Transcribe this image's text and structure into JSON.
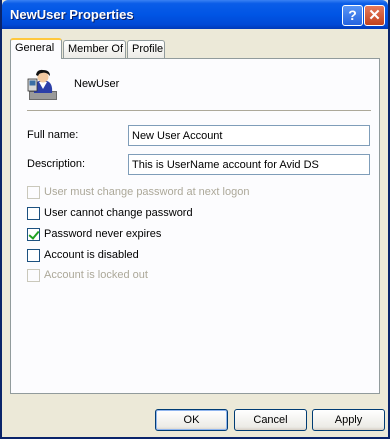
{
  "window": {
    "title": "NewUser Properties",
    "help_glyph": "?",
    "close_glyph": "✕"
  },
  "tabs": [
    {
      "label": "General",
      "active": true
    },
    {
      "label": "Member Of",
      "active": false
    },
    {
      "label": "Profile",
      "active": false
    }
  ],
  "user": {
    "name": "NewUser",
    "icon": "user-icon"
  },
  "fields": {
    "full_name": {
      "label": "Full name:",
      "value": "New User Account"
    },
    "description": {
      "label": "Description:",
      "value": "This is UserName account for Avid DS"
    }
  },
  "options": [
    {
      "label": "User must change password at next logon",
      "checked": false,
      "enabled": false
    },
    {
      "label": "User cannot change password",
      "checked": false,
      "enabled": true
    },
    {
      "label": "Password never expires",
      "checked": true,
      "enabled": true
    },
    {
      "label": "Account is disabled",
      "checked": false,
      "enabled": true
    },
    {
      "label": "Account is locked out",
      "checked": false,
      "enabled": false
    }
  ],
  "buttons": {
    "ok": "OK",
    "cancel": "Cancel",
    "apply": "Apply"
  },
  "colors": {
    "titlebar": "#0055e5",
    "active_tab_accent": "#ffc83c",
    "checkmark": "#21a121"
  }
}
